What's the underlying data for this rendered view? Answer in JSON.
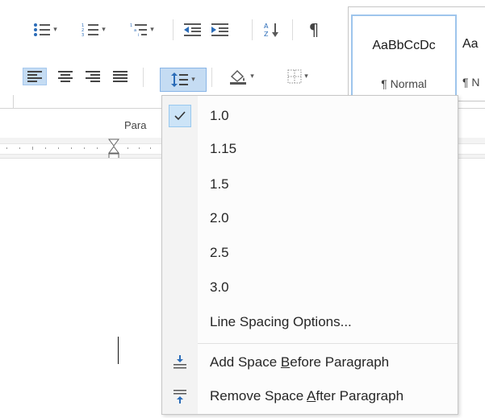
{
  "ribbon": {
    "group_label": "Para",
    "styles": [
      {
        "sample": "AaBbCcDc",
        "name": "¶ Normal"
      },
      {
        "sample": "Aa",
        "name": "¶ N"
      }
    ]
  },
  "line_spacing_menu": {
    "items": [
      {
        "label": "1.0",
        "checked": true
      },
      {
        "label": "1.15"
      },
      {
        "label": "1.5"
      },
      {
        "label": "2.0"
      },
      {
        "label": "2.5"
      },
      {
        "label": "3.0"
      },
      {
        "label": "Line Spacing Options..."
      }
    ],
    "add_space": {
      "prefix": "Add Space ",
      "access": "B",
      "suffix": "efore Paragraph"
    },
    "remove_space": {
      "prefix": "Remove Space ",
      "access": "A",
      "suffix": "fter Paragraph"
    }
  },
  "colors": {
    "accent_highlight": "#c5dcf3",
    "menu_check": "#cce4f7",
    "icon_blue": "#2b6cb8"
  }
}
